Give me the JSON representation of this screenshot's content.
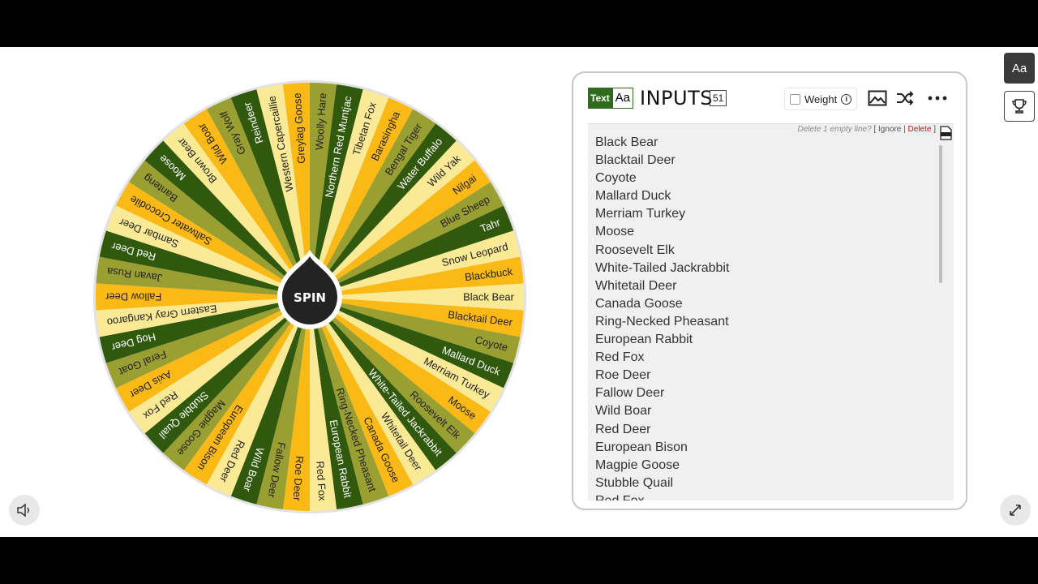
{
  "wheel": {
    "spin_label": "SPIN",
    "slice_colors": [
      "#faea95",
      "#fab915",
      "#9a9f32",
      "#30590e"
    ],
    "text_colors": [
      "#222222",
      "#222222",
      "#222222",
      "#ffffff"
    ],
    "slices": [
      "Black Bear",
      "Blacktail Deer",
      "Coyote",
      "Mallard Duck",
      "Merriam Turkey",
      "Moose",
      "Roosevelt Elk",
      "White-Tailed Jackrabbit",
      "Whitetail Deer",
      "Canada Goose",
      "Ring-Necked Pheasant",
      "European Rabbit",
      "Red Fox",
      "Roe Deer",
      "Fallow Deer",
      "Wild Boar",
      "Red Deer",
      "European Bison",
      "Magpie Goose",
      "Stubble Quail",
      "Red Fox",
      "Axis Deer",
      "Feral Goat",
      "Hog Deer",
      "Eastern Gray Kangaroo",
      "Fallow Deer",
      "Javan Rusa",
      "Red Deer",
      "Sambar Deer",
      "Saltwater Crocodile",
      "Banteng",
      "Moose",
      "Brown Bear",
      "Wild Boar",
      "Gray Wolf",
      "Reindeer",
      "Western Capercaillie",
      "Greylag Goose",
      "Woolly Hare",
      "Northern Red Muntjac",
      "Tibetan Fox",
      "Barasingha",
      "Bengal Tiger",
      "Water Buffalo",
      "Wild Yak",
      "Nilgai",
      "Blue Sheep",
      "Tahr",
      "Snow Leopard",
      "Blackbuck"
    ]
  },
  "panel": {
    "badge_text": "Text",
    "badge_aa": "Aa",
    "title": "INPUTS",
    "count": "51",
    "weight_label": "Weight",
    "empty_line_prompt": "Delete 1 empty line?",
    "open_bracket": "[",
    "ignore_label": "Ignore",
    "separator": "|",
    "delete_label": "Delete",
    "close_bracket": "]",
    "inputs": [
      "Black Bear",
      "Blacktail Deer",
      "Coyote",
      "Mallard Duck",
      "Merriam Turkey",
      "Moose",
      "Roosevelt Elk",
      "White-Tailed Jackrabbit",
      "Whitetail Deer",
      "Canada Goose",
      "Ring-Necked Pheasant",
      "European Rabbit",
      "Red Fox",
      "Roe Deer",
      "Fallow Deer",
      "Wild Boar",
      "Red Deer",
      "European Bison",
      "Magpie Goose",
      "Stubble Quail",
      "Red Fox"
    ]
  },
  "side": {
    "theme_label": "Aa"
  },
  "icons": [
    "font-style-icon",
    "trophy-icon",
    "image-icon",
    "shuffle-icon",
    "more-icon",
    "info-icon",
    "csv-file-icon",
    "speaker-icon",
    "fullscreen-icon"
  ]
}
